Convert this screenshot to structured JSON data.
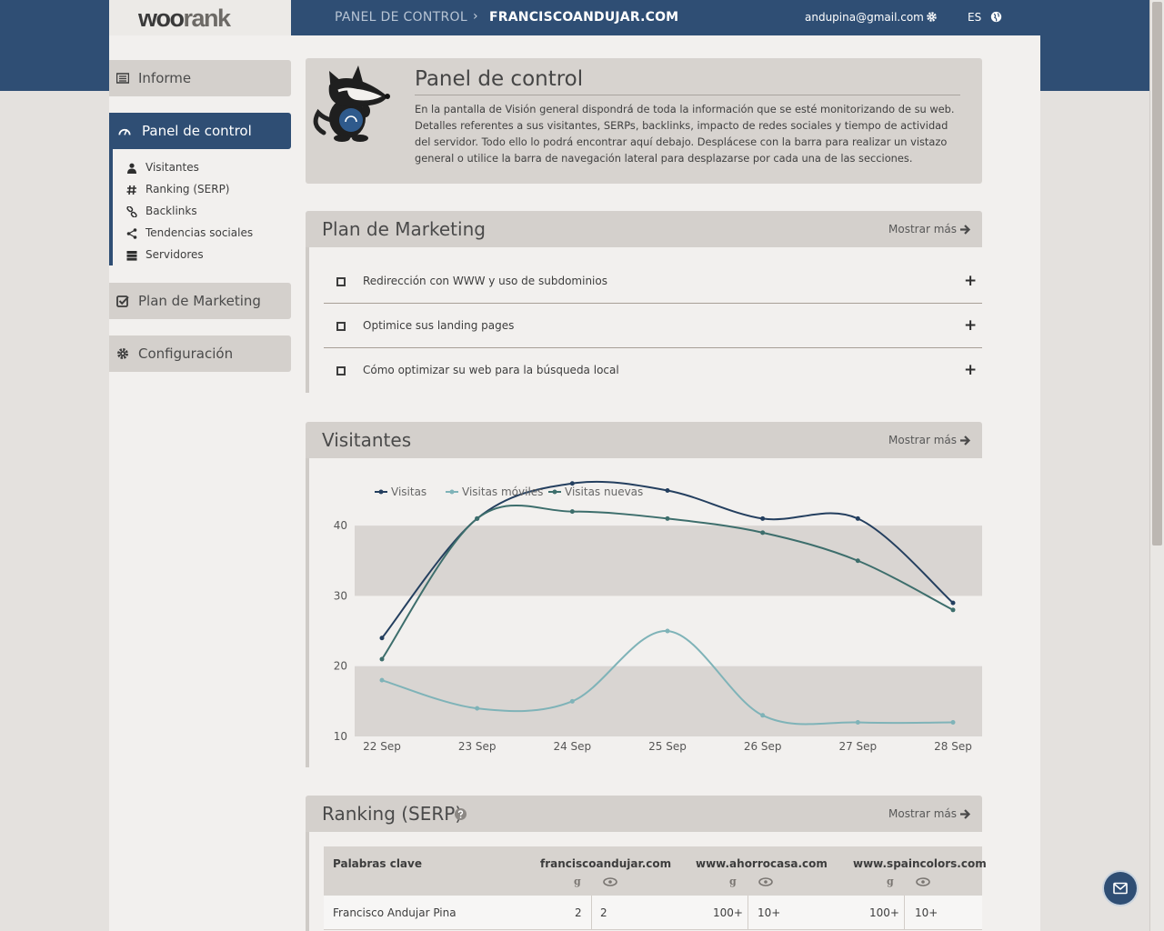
{
  "header": {
    "logo": "woorank",
    "breadcrumb_section": "PANEL DE CONTROL",
    "breadcrumb_separator": "›",
    "breadcrumb_site": "FRANCISCOANDUJAR.COM",
    "user_email": "andupina@gmail.com",
    "language": "ES",
    "icons": [
      "gear-icon",
      "globe-icon"
    ]
  },
  "sidebar": {
    "items": [
      {
        "label": "Informe",
        "icon": "report-icon"
      },
      {
        "label": "Panel de control",
        "icon": "gauge-icon",
        "active": true
      },
      {
        "label": "Plan de Marketing",
        "icon": "checkbox-icon"
      },
      {
        "label": "Configuración",
        "icon": "gear-icon"
      }
    ],
    "subitems": [
      {
        "label": "Visitantes",
        "icon": "user-icon"
      },
      {
        "label": "Ranking (SERP)",
        "icon": "hash-icon"
      },
      {
        "label": "Backlinks",
        "icon": "link-icon"
      },
      {
        "label": "Tendencias sociales",
        "icon": "share-icon"
      },
      {
        "label": "Servidores",
        "icon": "server-icon"
      }
    ]
  },
  "intro": {
    "title": "Panel de control",
    "text": "En la pantalla de Visión general dispondrá de toda la información que se esté monitorizando de su web. Detalles referentes a sus visitantes, SERPs, backlinks, impacto de redes sociales y tiempo de actividad del servidor. Todo ello lo podrá encontrar aquí debajo. Desplácese con la barra para realizar un vistazo general o utilice la barra de navegación lateral para desplazarse por cada una de las secciones."
  },
  "marketing": {
    "title": "Plan de Marketing",
    "more": "Mostrar más",
    "items": [
      "Redirección con WWW y uso de subdominios",
      "Optimice sus landing pages",
      "Cómo optimizar su web para la búsqueda local"
    ]
  },
  "visitors": {
    "title": "Visitantes",
    "more": "Mostrar más"
  },
  "chart_data": {
    "type": "line",
    "x": [
      "22 Sep",
      "23 Sep",
      "24 Sep",
      "25 Sep",
      "26 Sep",
      "27 Sep",
      "28 Sep"
    ],
    "series": [
      {
        "name": "Visitas",
        "color": "#243f5f",
        "values": [
          24,
          41,
          46,
          45,
          41,
          41,
          29
        ]
      },
      {
        "name": "Visitas móviles",
        "color": "#7fb3b8",
        "values": [
          18,
          14,
          15,
          25,
          13,
          12,
          12
        ]
      },
      {
        "name": "Visitas nuevas",
        "color": "#3d6e6c",
        "values": [
          21,
          41,
          42,
          41,
          39,
          35,
          28
        ]
      }
    ],
    "yticks": [
      10,
      20,
      30,
      40
    ],
    "ylim": [
      10,
      47
    ],
    "legend": "top-left",
    "bands": [
      [
        10,
        20
      ],
      [
        30,
        40
      ]
    ],
    "band_color": "#d9d5d2"
  },
  "ranking": {
    "title": "Ranking (SERP)",
    "more": "Mostrar más",
    "columns": [
      "Palabras clave",
      "franciscoandujar.com",
      "www.ahorrocasa.com",
      "www.spaincolors.com"
    ],
    "rows": [
      {
        "keyword": "Francisco Andujar Pina",
        "values": [
          "2",
          "2",
          "100+",
          "10+",
          "100+",
          "10+"
        ]
      }
    ]
  },
  "colors": {
    "brand": "#2f4e74",
    "panel": "#d4d0cc",
    "background": "#f2f0ee"
  }
}
